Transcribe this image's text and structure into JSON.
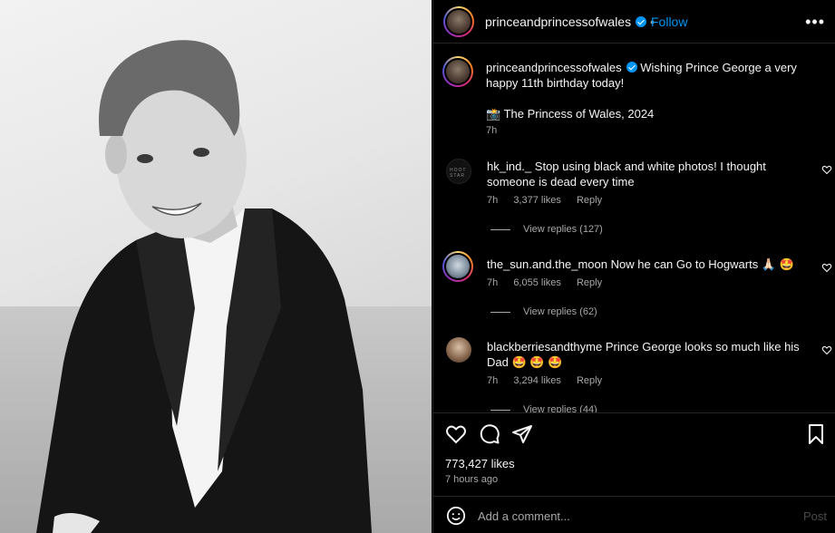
{
  "post": {
    "username": "princeandprincessofwales",
    "follow_label": "Follow",
    "more_label": "•••",
    "separator": "•",
    "caption": "Wishing Prince George a very happy 11th birthday today!",
    "credit_emoji": "📸",
    "credit": "The Princess of Wales, 2024",
    "caption_time": "7h",
    "likes": "773,427 likes",
    "time_ago": "7 hours ago",
    "comment_placeholder": "Add a comment...",
    "post_label": "Post"
  },
  "comments": [
    {
      "username": "hk_ind._",
      "avatar_text": "HOOT STAR",
      "text": "Stop using black and white photos! I thought someone is dead every time",
      "time": "7h",
      "likes": "3,377 likes",
      "reply": "Reply",
      "view_replies": "View replies (127)"
    },
    {
      "username": "the_sun.and.the_moon",
      "text": "Now he can Go to Hogwarts 🙏🏻 🤩",
      "time": "7h",
      "likes": "6,055 likes",
      "reply": "Reply",
      "view_replies": "View replies (62)"
    },
    {
      "username": "blackberriesandthyme",
      "text": "Prince George looks so much like his Dad 🤩 🤩 🤩",
      "time": "7h",
      "likes": "3,294 likes",
      "reply": "Reply",
      "view_replies": "View replies (44)"
    }
  ],
  "icons": {
    "like": "heart-icon",
    "comment": "comment-icon",
    "share": "share-icon",
    "save": "bookmark-icon",
    "emoji": "smiley-icon",
    "verified": "verified-badge-icon"
  },
  "colors": {
    "background": "#000000",
    "accent": "#0095f6",
    "muted": "#a8a8a8",
    "divider": "#262626"
  }
}
